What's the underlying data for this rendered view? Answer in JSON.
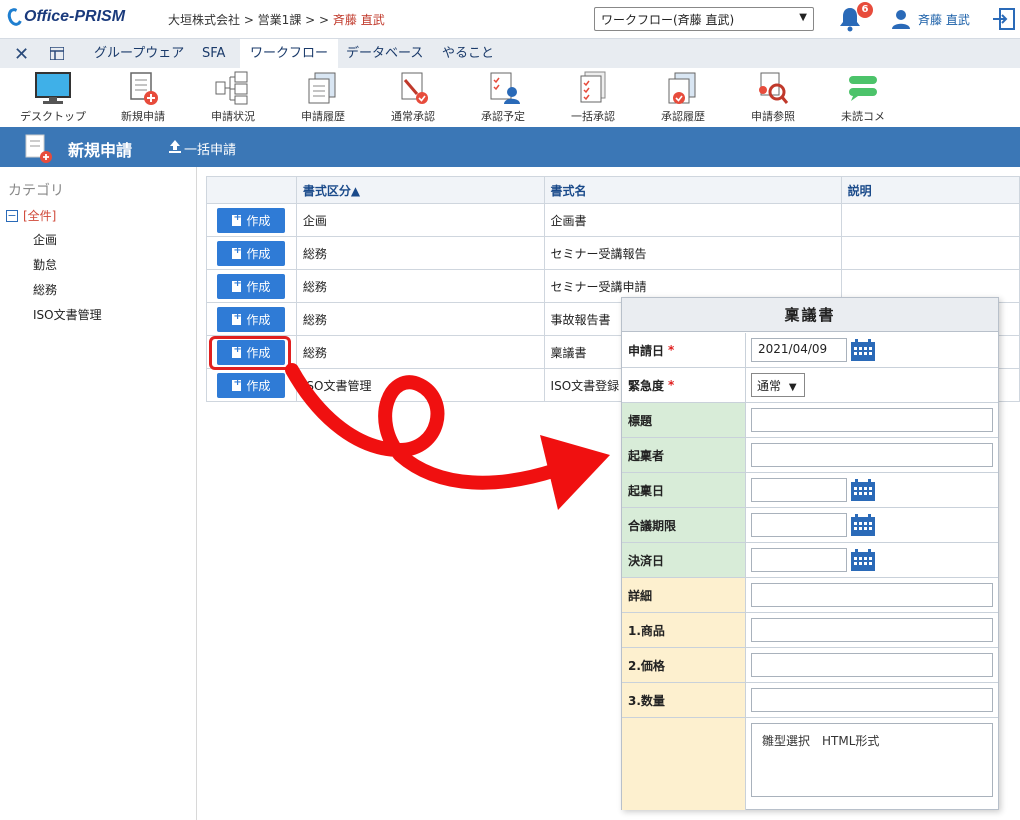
{
  "app": {
    "logo": "Office-PRISM"
  },
  "breadcrumb": {
    "path": "大垣株式会社 > 営業1課 > > ",
    "user": "斉藤 直武"
  },
  "workflow_select": {
    "value": "ワークフロー(斉藤 直武)"
  },
  "notifications": {
    "count": "6"
  },
  "user": {
    "name": "斉藤 直武"
  },
  "tabs": [
    {
      "label": "グループウェア"
    },
    {
      "label": "SFA"
    },
    {
      "label": "ワークフロー"
    },
    {
      "label": "データベース"
    },
    {
      "label": "やること"
    }
  ],
  "toolbar": [
    {
      "label": "デスクトップ",
      "icon": "monitor-icon"
    },
    {
      "label": "新規申請",
      "icon": "new-doc-icon"
    },
    {
      "label": "申請状況",
      "icon": "flow-icon"
    },
    {
      "label": "申請履歴",
      "icon": "history-icon"
    },
    {
      "label": "通常承認",
      "icon": "approve-icon"
    },
    {
      "label": "承認予定",
      "icon": "schedule-icon"
    },
    {
      "label": "一括承認",
      "icon": "bulk-icon"
    },
    {
      "label": "承認履歴",
      "icon": "approve-history-icon"
    },
    {
      "label": "申請参照",
      "icon": "search-doc-icon"
    },
    {
      "label": "未読コメ",
      "icon": "comment-icon"
    }
  ],
  "header": {
    "title": "新規申請",
    "bulk_label": "一括申請"
  },
  "sidebar": {
    "title": "カテゴリ",
    "all_label": "[全件]",
    "items": [
      "企画",
      "勤怠",
      "総務",
      "ISO文書管理"
    ]
  },
  "table": {
    "headers": [
      "",
      "書式区分▲",
      "書式名",
      "説明"
    ],
    "create_label": "作成",
    "rows": [
      {
        "category": "企画",
        "name": "企画書"
      },
      {
        "category": "総務",
        "name": "セミナー受講報告"
      },
      {
        "category": "総務",
        "name": "セミナー受講申請"
      },
      {
        "category": "総務",
        "name": "事故報告書"
      },
      {
        "category": "総務",
        "name": "稟議書"
      },
      {
        "category": "ISO文書管理",
        "name": "ISO文書登録"
      }
    ]
  },
  "form": {
    "title": "稟議書",
    "fields": {
      "apply_date": {
        "label": "申請日",
        "value": "2021/04/09"
      },
      "urgency": {
        "label": "緊急度",
        "value": "通常"
      },
      "subject": {
        "label": "標題"
      },
      "drafter": {
        "label": "起稟者"
      },
      "draft_date": {
        "label": "起稟日"
      },
      "deadline": {
        "label": "合議期限"
      },
      "decision_date": {
        "label": "決済日"
      },
      "detail": {
        "label": "詳細"
      },
      "item1": {
        "label": "1.商品"
      },
      "item2": {
        "label": "2.価格"
      },
      "item3": {
        "label": "3.数量"
      },
      "memo": {
        "value": "雛型選択　HTML形式"
      }
    }
  },
  "colors": {
    "accent": "#3b77b6",
    "button": "#2f7bd6",
    "required": "#e02020",
    "group_green": "#d8ecd8",
    "group_yellow": "#fdf0cf"
  }
}
